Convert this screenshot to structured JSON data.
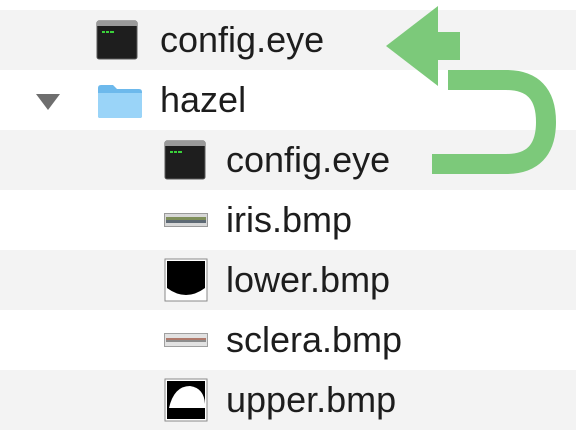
{
  "files": [
    {
      "name": "config.eye",
      "icon": "terminal-file-icon",
      "indent": 0
    },
    {
      "name": "hazel",
      "icon": "folder-icon",
      "indent": 0,
      "expanded": true
    },
    {
      "name": "config.eye",
      "icon": "terminal-file-icon",
      "indent": 1
    },
    {
      "name": "iris.bmp",
      "icon": "iris-image-icon",
      "indent": 1
    },
    {
      "name": "lower.bmp",
      "icon": "lower-eyelid-image-icon",
      "indent": 1
    },
    {
      "name": "sclera.bmp",
      "icon": "sclera-image-icon",
      "indent": 1
    },
    {
      "name": "upper.bmp",
      "icon": "upper-eyelid-image-icon",
      "indent": 1
    }
  ],
  "colors": {
    "row_stripe": "#f3f3f3",
    "folder": "#8fcdf5",
    "arrow": "#7cc97a",
    "text": "#1d1d1d"
  }
}
